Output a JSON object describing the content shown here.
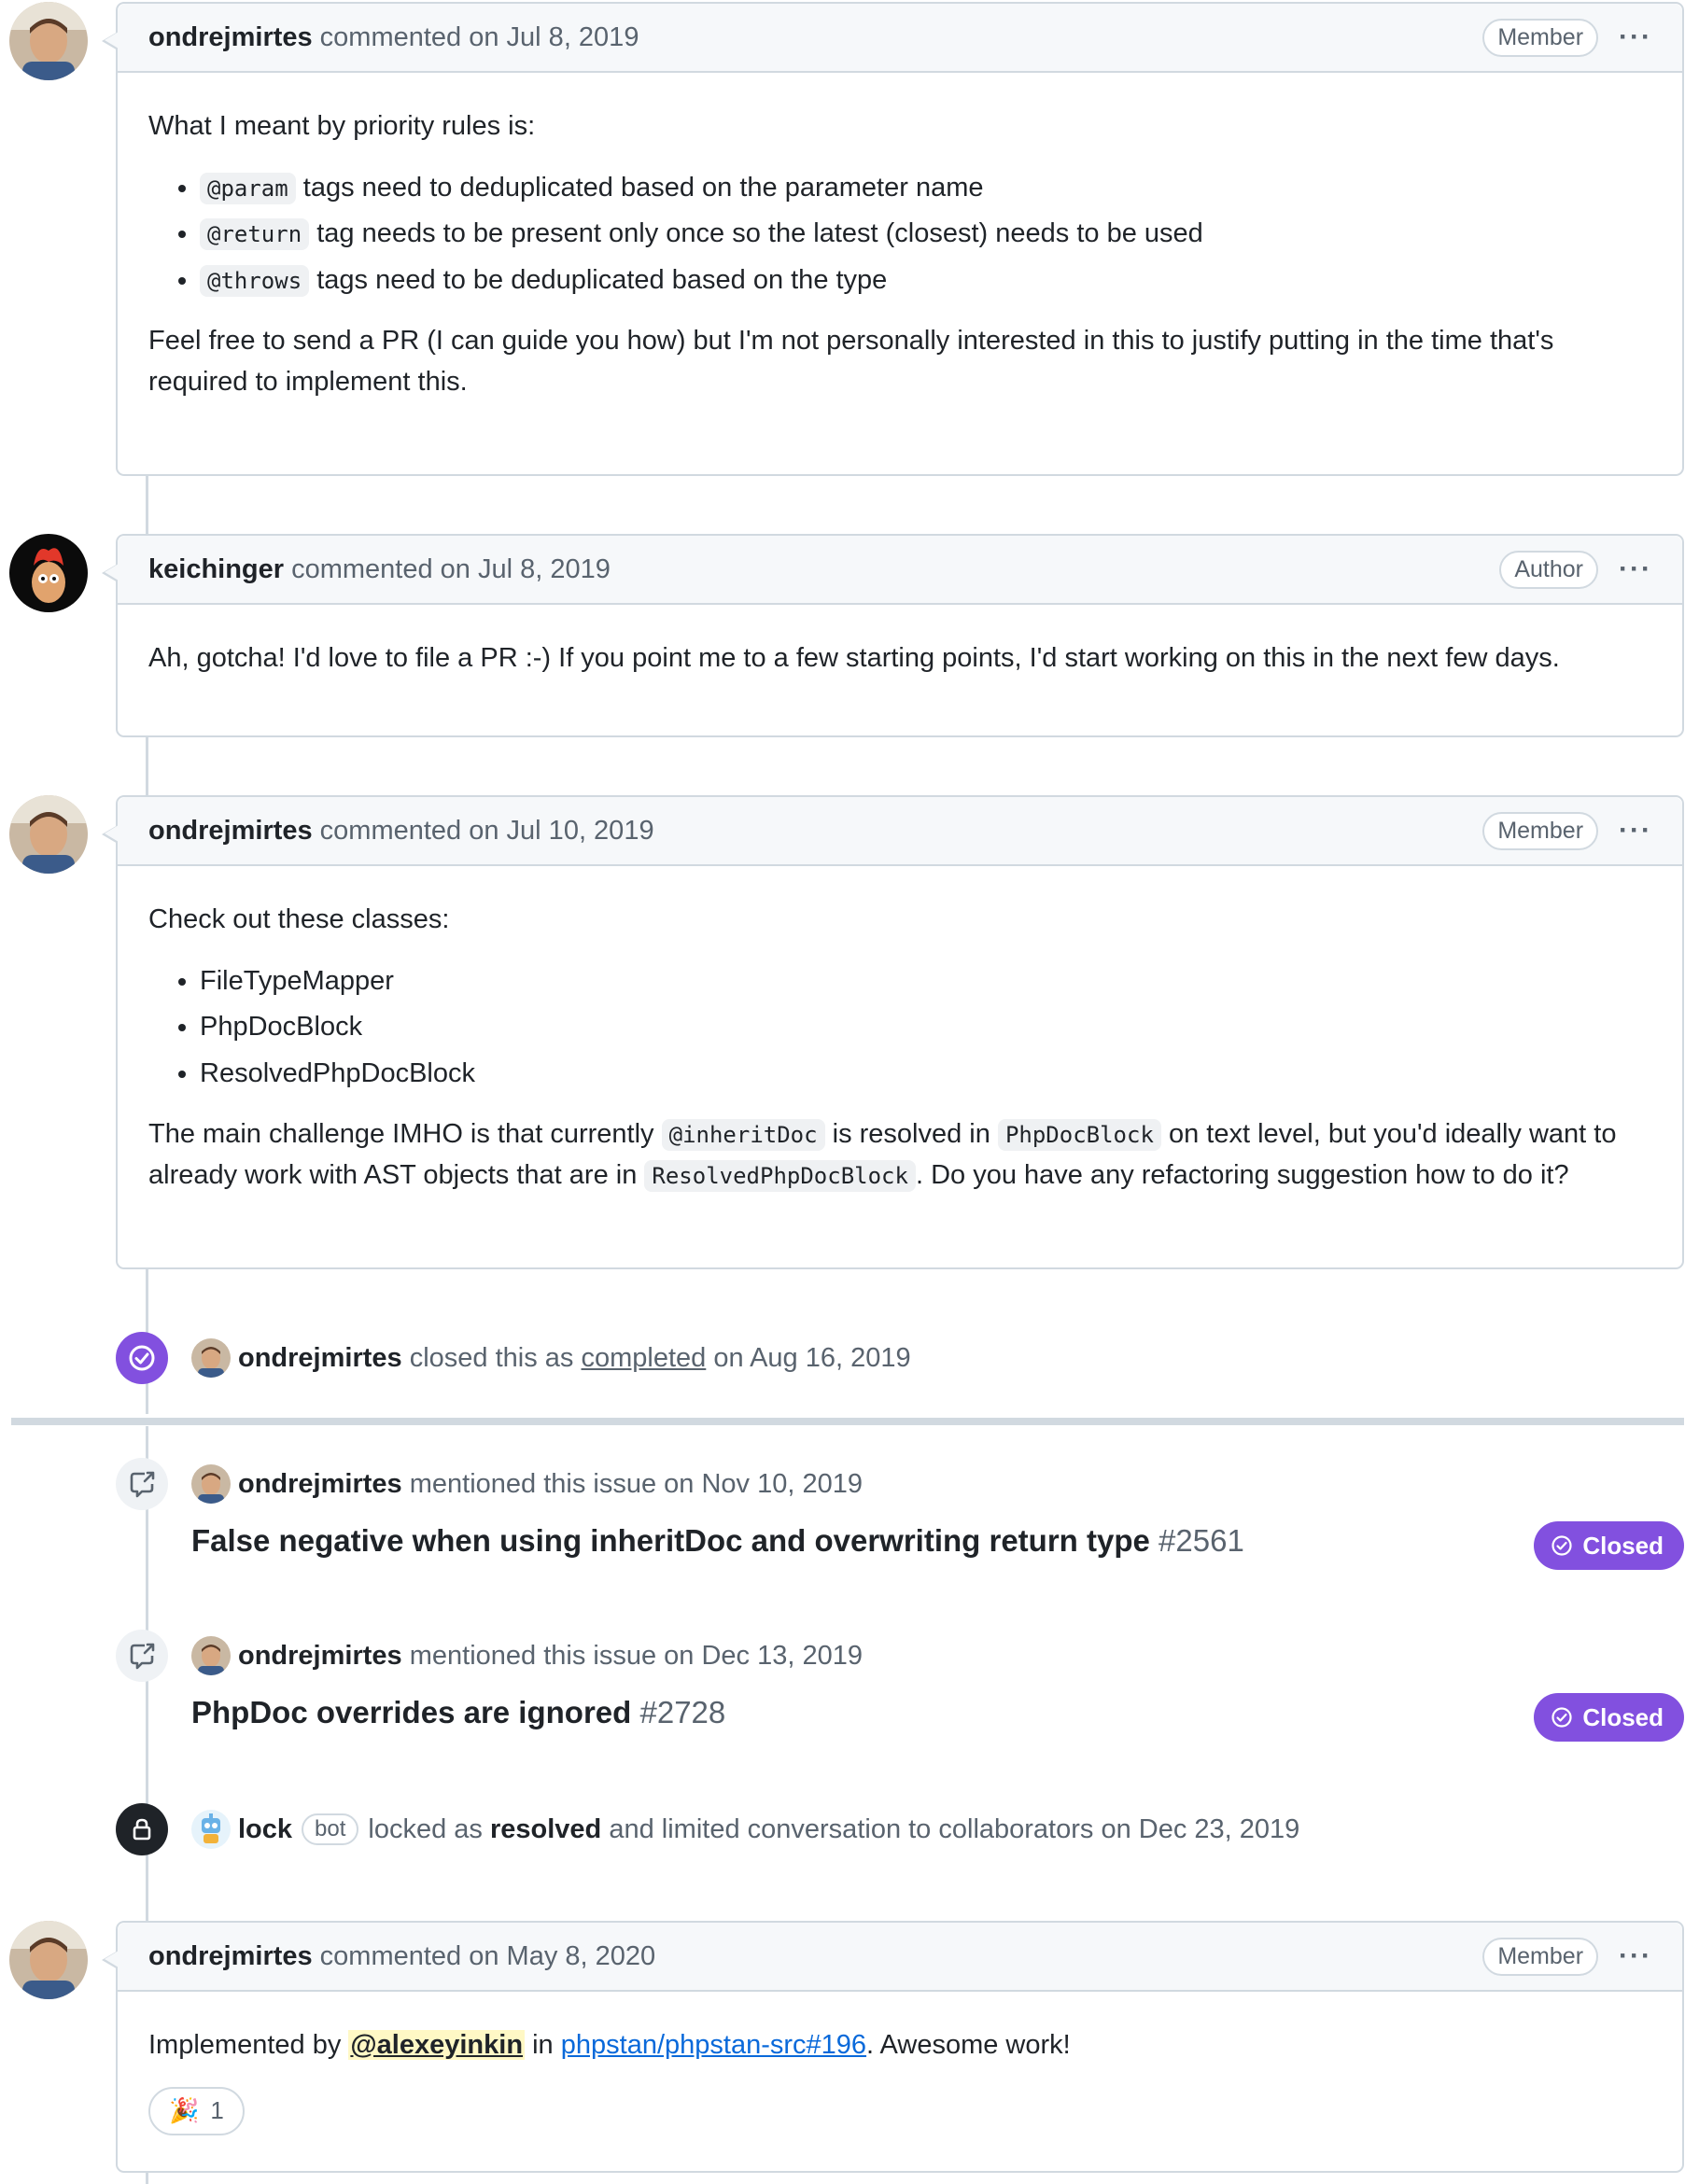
{
  "comments": [
    {
      "author": "ondrejmirtes",
      "meta": "commented on Jul 8, 2019",
      "role": "Member",
      "intro": "What I meant by priority rules is:",
      "bullets": [
        {
          "code": "@param",
          "text": "tags need to deduplicated based on the parameter name"
        },
        {
          "code": "@return",
          "text": "tag needs to be present only once so the latest (closest) needs to be used"
        },
        {
          "code": "@throws",
          "text": "tags need to be deduplicated based on the type"
        }
      ],
      "outro": "Feel free to send a PR (I can guide you how) but I'm not personally interested in this to justify putting in the time that's required to implement this."
    },
    {
      "author": "keichinger",
      "meta": "commented on Jul 8, 2019",
      "role": "Author",
      "text": "Ah, gotcha! I'd love to file a PR :-) If you point me to a few starting points, I'd start working on this in the next few days."
    },
    {
      "author": "ondrejmirtes",
      "meta": "commented on Jul 10, 2019",
      "role": "Member",
      "intro": "Check out these classes:",
      "bullets": [
        "FileTypeMapper",
        "PhpDocBlock",
        "ResolvedPhpDocBlock"
      ],
      "p1": "The main challenge IMHO is that currently",
      "code1": "@inheritDoc",
      "p2": "is resolved in",
      "code2": "PhpDocBlock",
      "p3": "on text level, but you'd ideally want to already work with AST objects that are in",
      "code3": "ResolvedPhpDocBlock",
      "p4": ". Do you have any refactoring suggestion how to do it?"
    },
    {
      "author": "ondrejmirtes",
      "meta": "commented on May 8, 2020",
      "role": "Member",
      "t1": "Implemented by",
      "mention": "@alexeyinkin",
      "t2": "in",
      "link": "phpstan/phpstan-src#196",
      "t3": ". Awesome work!",
      "reaction_emoji": "🎉",
      "reaction_count": "1"
    }
  ],
  "closed_event": {
    "author": "ondrejmirtes",
    "t1": "closed this as",
    "state": "completed",
    "t2": "on Aug 16, 2019",
    "icon": "check-circle-icon",
    "color": "#8250df"
  },
  "mentions": [
    {
      "author": "ondrejmirtes",
      "text": "mentioned this issue on Nov 10, 2019",
      "title": "False negative when using inheritDoc and overwriting return type",
      "number": "#2561",
      "status": "Closed"
    },
    {
      "author": "ondrejmirtes",
      "text": "mentioned this issue on Dec 13, 2019",
      "title": "PhpDoc overrides are ignored",
      "number": "#2728",
      "status": "Closed"
    }
  ],
  "lock_event": {
    "author": "lock",
    "badge": "bot",
    "t1": "locked as",
    "reason": "resolved",
    "t2": "and limited conversation to collaborators on Dec 23, 2019",
    "icon": "lock-icon"
  },
  "colors": {
    "purple": "#8250df",
    "border": "#d1d9e0",
    "link": "#0969da",
    "mention_bg": "#fff8c5"
  }
}
